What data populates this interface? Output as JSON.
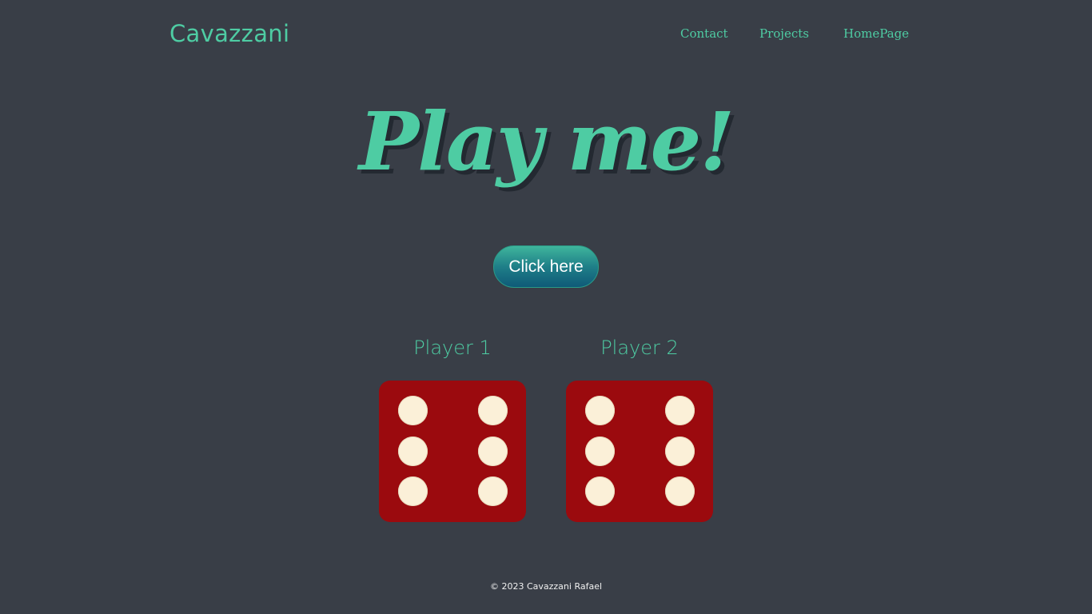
{
  "header": {
    "brand": "Cavazzani",
    "nav": [
      {
        "label": "Contact"
      },
      {
        "label": "Projects"
      },
      {
        "label": "HomePage"
      }
    ]
  },
  "main": {
    "title": "Play me!",
    "button_label": "Click here",
    "players": [
      {
        "label": "Player 1",
        "die_value": 6
      },
      {
        "label": "Player 2",
        "die_value": 6
      }
    ]
  },
  "footer": {
    "text": "© 2023 Cavazzani Rafael"
  },
  "colors": {
    "background": "#393e47",
    "accent": "#4ecca3",
    "die": "#9b0a0e",
    "pip": "#fbf0d8"
  }
}
